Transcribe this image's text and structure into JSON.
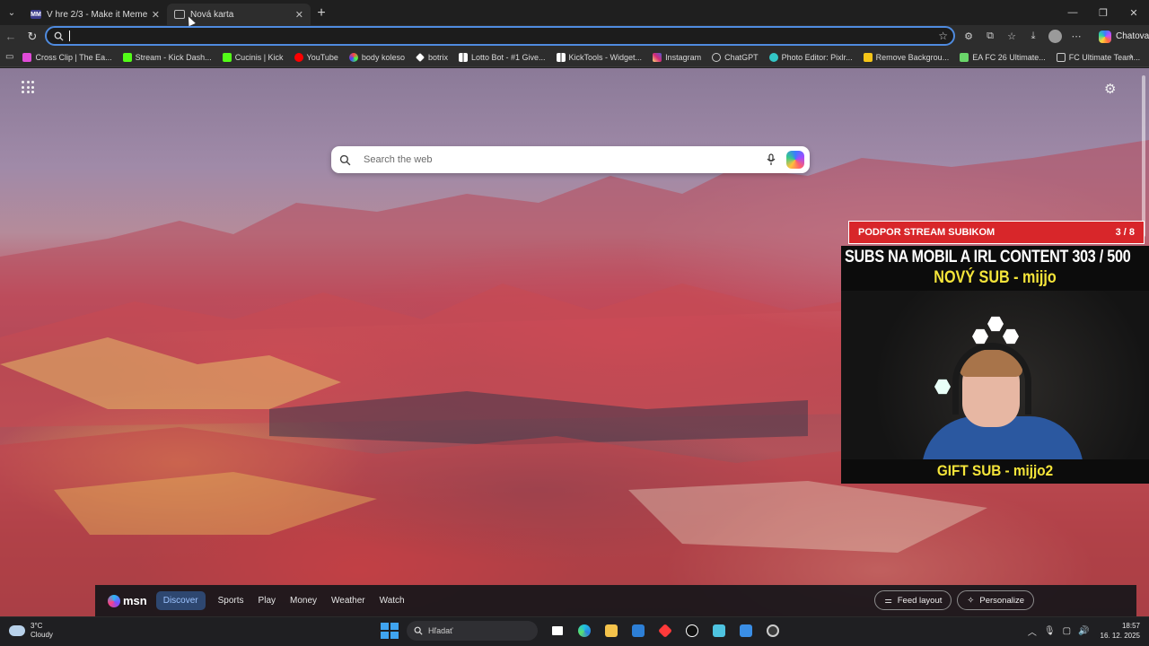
{
  "tabs": [
    {
      "label": "V hre 2/3 - Make it Meme",
      "favicon": "MM"
    },
    {
      "label": "Nová karta"
    }
  ],
  "toolbar": {
    "address_value": "",
    "chat_button": "Chatovať"
  },
  "bookmarks": [
    {
      "label": "Cross Clip | The Ea...",
      "color": "#e04bd8"
    },
    {
      "label": "Stream - Kick Dash...",
      "color": "#53fc18"
    },
    {
      "label": "Cucinis | Kick",
      "color": "#53fc18"
    },
    {
      "label": "YouTube",
      "color": "#ff0000"
    },
    {
      "label": "body koleso",
      "color": "#4caf50"
    },
    {
      "label": "botrix",
      "color": "#ffffff"
    },
    {
      "label": "Lotto Bot - #1 Give...",
      "color": "#ffffff"
    },
    {
      "label": "KickTools - Widget...",
      "color": "#ffffff"
    },
    {
      "label": "Instagram",
      "color": "#e1306c"
    },
    {
      "label": "ChatGPT",
      "color": "#cccccc"
    },
    {
      "label": "Photo Editor: Pixlr...",
      "color": "#33c6c6"
    },
    {
      "label": "Remove Backgrou...",
      "color": "#f5c518"
    },
    {
      "label": "EA FC 26 Ultimate...",
      "color": "#6ad66a"
    },
    {
      "label": "FC Ultimate Team...",
      "color": "#cccccc"
    }
  ],
  "newtab": {
    "search_placeholder": "Search the web"
  },
  "overlay": {
    "banner_label": "PODPOR STREAM SUBIKOM",
    "banner_count": "3 / 8",
    "goal_line": "SUBS NA MOBIL A IRL CONTENT  303 / 500",
    "new_sub": "NOVÝ SUB - mijjo",
    "gift_sub": "GIFT SUB - mijjo2"
  },
  "msn": {
    "logo": "msn",
    "tabs": [
      "Discover",
      "Sports",
      "Play",
      "Money",
      "Weather",
      "Watch"
    ],
    "feed_layout": "Feed layout",
    "personalize": "Personalize"
  },
  "taskbar": {
    "weather_temp": "3°C",
    "weather_desc": "Cloudy",
    "search_placeholder": "Hľadať",
    "time": "18:57",
    "date": "16. 12. 2025"
  }
}
